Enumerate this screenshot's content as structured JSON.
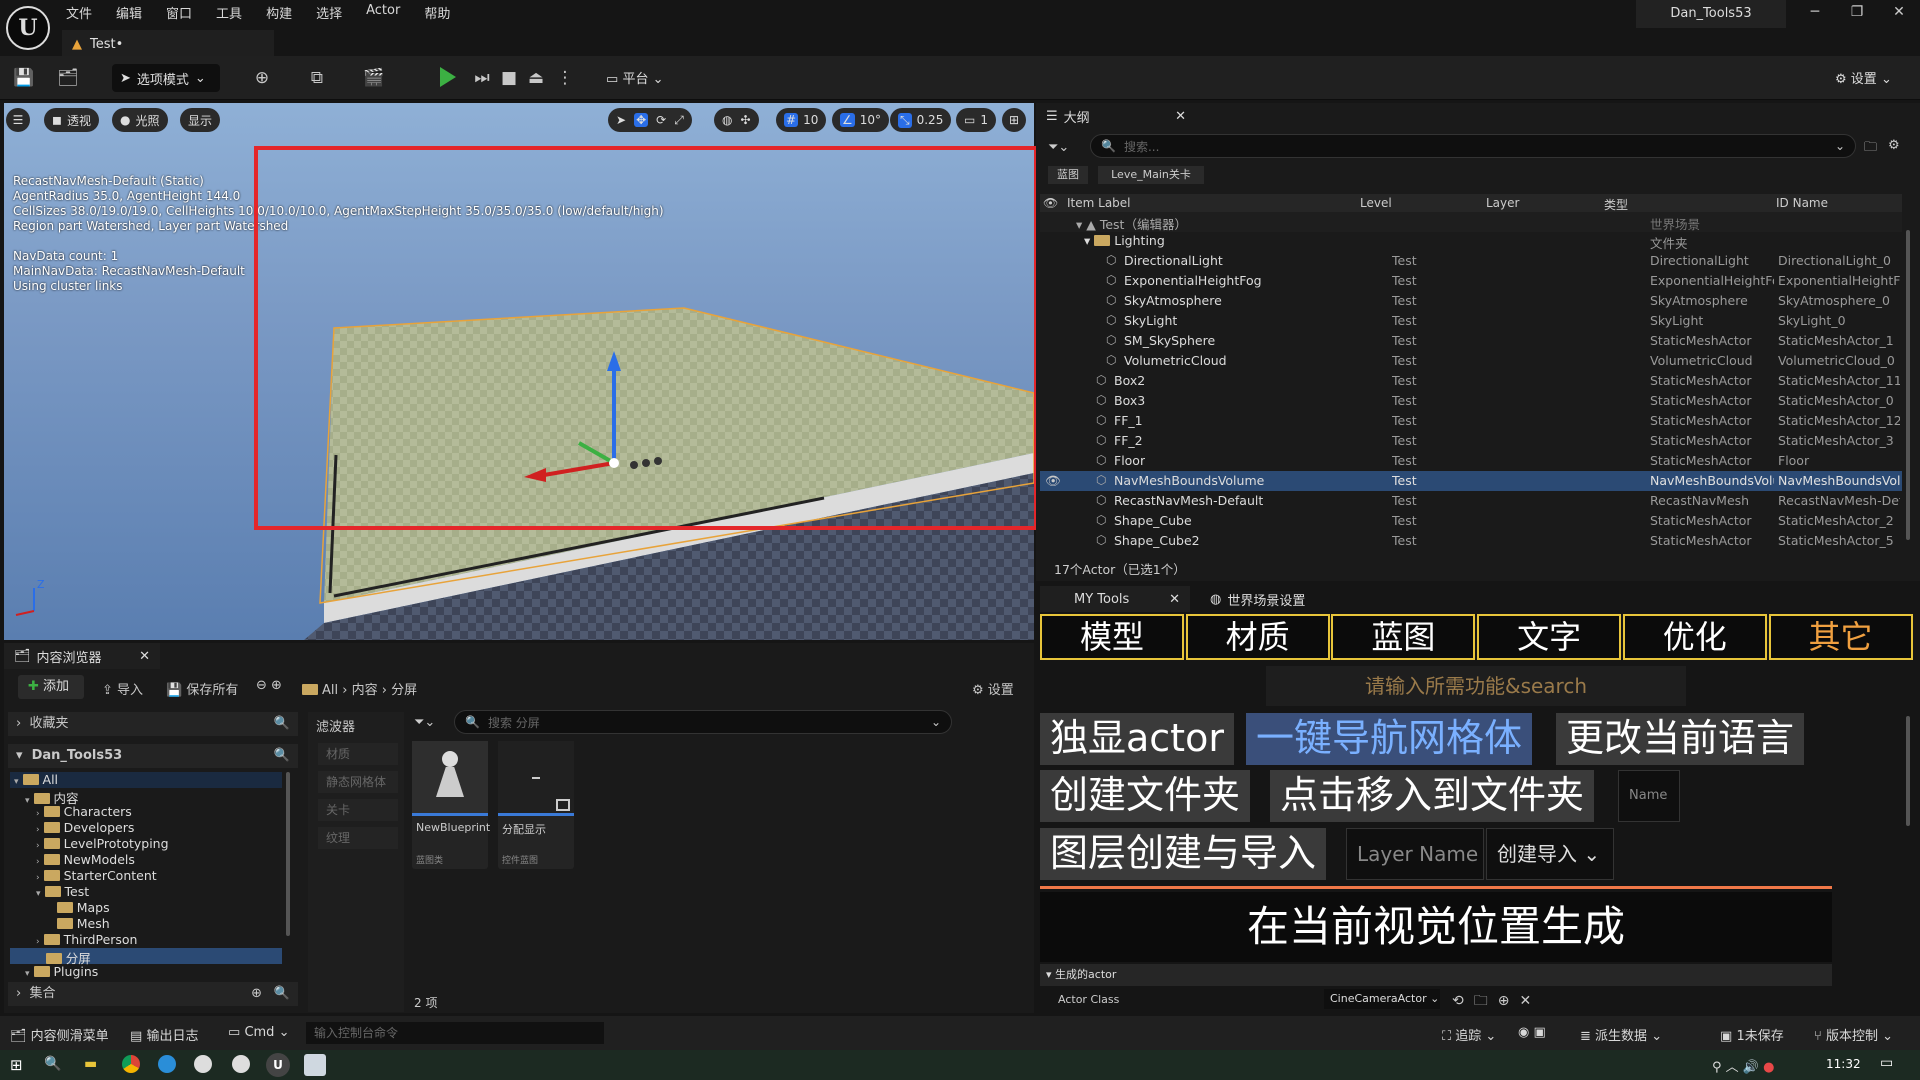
{
  "menu": [
    "文件",
    "编辑",
    "窗口",
    "工具",
    "构建",
    "选择",
    "Actor",
    "帮助"
  ],
  "doc_tab": "Test•",
  "project": "Dan_Tools53",
  "toolbar": {
    "mode": "选项模式",
    "platform": "平台",
    "settings": "设置"
  },
  "viewport": {
    "buttons": [
      "透视",
      "光照",
      "显示"
    ],
    "grid": "10",
    "angle": "10°",
    "scale": "0.25",
    "camera": "1",
    "info": [
      "RecastNavMesh-Default (Static)",
      "AgentRadius 35.0, AgentHeight 144.0",
      "CellSizes 38.0/19.0/19.0, CellHeights 10.0/10.0/10.0, AgentMaxStepHeight 35.0/35.0/35.0 (low/default/high)",
      "Region part Watershed, Layer part Watershed"
    ],
    "info2": [
      "NavData count: 1",
      "MainNavData: RecastNavMesh-Default",
      "Using cluster links"
    ]
  },
  "outliner": {
    "tab": "大纲",
    "search": "搜索...",
    "chips": [
      "蓝图",
      "Leve_Main关卡"
    ],
    "columns": [
      "Item Label",
      "Level",
      "Layer",
      "类型",
      "ID Name"
    ],
    "world": "Test（编辑器）",
    "world_type": "世界场景",
    "folder": "Lighting",
    "folder_type": "文件夹",
    "rows": [
      {
        "name": "DirectionalLight",
        "level": "Test",
        "type": "DirectionalLight",
        "id": "DirectionalLight_0",
        "indent": 2
      },
      {
        "name": "ExponentialHeightFog",
        "level": "Test",
        "type": "ExponentialHeightFog",
        "id": "ExponentialHeightFog",
        "indent": 2
      },
      {
        "name": "SkyAtmosphere",
        "level": "Test",
        "type": "SkyAtmosphere",
        "id": "SkyAtmosphere_0",
        "indent": 2
      },
      {
        "name": "SkyLight",
        "level": "Test",
        "type": "SkyLight",
        "id": "SkyLight_0",
        "indent": 2
      },
      {
        "name": "SM_SkySphere",
        "level": "Test",
        "type": "StaticMeshActor",
        "id": "StaticMeshActor_1",
        "indent": 2
      },
      {
        "name": "VolumetricCloud",
        "level": "Test",
        "type": "VolumetricCloud",
        "id": "VolumetricCloud_0",
        "indent": 2
      },
      {
        "name": "Box2",
        "level": "Test",
        "type": "StaticMeshActor",
        "id": "StaticMeshActor_11",
        "indent": 1
      },
      {
        "name": "Box3",
        "level": "Test",
        "type": "StaticMeshActor",
        "id": "StaticMeshActor_0",
        "indent": 1
      },
      {
        "name": "FF_1",
        "level": "Test",
        "type": "StaticMeshActor",
        "id": "StaticMeshActor_12",
        "indent": 1
      },
      {
        "name": "FF_2",
        "level": "Test",
        "type": "StaticMeshActor",
        "id": "StaticMeshActor_3",
        "indent": 1
      },
      {
        "name": "Floor",
        "level": "Test",
        "type": "StaticMeshActor",
        "id": "Floor",
        "indent": 1
      },
      {
        "name": "NavMeshBoundsVolume",
        "level": "Test",
        "type": "NavMeshBoundsVolume",
        "id": "NavMeshBoundsVolume",
        "indent": 1,
        "selected": true
      },
      {
        "name": "RecastNavMesh-Default",
        "level": "Test",
        "type": "RecastNavMesh",
        "id": "RecastNavMesh-Default",
        "indent": 1
      },
      {
        "name": "Shape_Cube",
        "level": "Test",
        "type": "StaticMeshActor",
        "id": "StaticMeshActor_2",
        "indent": 1
      },
      {
        "name": "Shape_Cube2",
        "level": "Test",
        "type": "StaticMeshActor",
        "id": "StaticMeshActor_5",
        "indent": 1
      }
    ],
    "count": "17个Actor（已选1个）"
  },
  "mytools": {
    "tab": "MY Tools",
    "tab2": "世界场景设置",
    "categories": [
      "模型",
      "材质",
      "蓝图",
      "文字",
      "优化",
      "其它"
    ],
    "search": "请输入所需功能&search",
    "b1": "独显actor",
    "b2": "一键导航网格体",
    "b3": "更改当前语言",
    "b4": "创建文件夹",
    "b5": "点击移入到文件夹",
    "name_ph": "Name",
    "b6": "图层创建与导入",
    "layer_ph": "Layer Name",
    "b7": "创建导入",
    "b8": "在当前视觉位置生成",
    "spawn_section": "生成的actor",
    "actor_class": "Actor Class",
    "actor_class_value": "CineCameraActor"
  },
  "content": {
    "tab": "内容浏览器",
    "add": "添加",
    "import": "导入",
    "save_all": "保存所有",
    "path": [
      "All",
      "内容",
      "分屏"
    ],
    "settings": "设置",
    "favorites": "收藏夹",
    "project": "Dan_Tools53",
    "collections": "集合",
    "tree": [
      {
        "label": "All",
        "depth": 0
      },
      {
        "label": "内容",
        "depth": 1
      },
      {
        "label": "Characters",
        "depth": 2
      },
      {
        "label": "Developers",
        "depth": 2
      },
      {
        "label": "LevelPrototyping",
        "depth": 2
      },
      {
        "label": "NewModels",
        "depth": 2
      },
      {
        "label": "StarterContent",
        "depth": 2
      },
      {
        "label": "Test",
        "depth": 2
      },
      {
        "label": "Maps",
        "depth": 3
      },
      {
        "label": "Mesh",
        "depth": 3
      },
      {
        "label": "ThirdPerson",
        "depth": 2
      },
      {
        "label": "分屏",
        "depth": 2,
        "selected": true
      },
      {
        "label": "Plugins",
        "depth": 1
      }
    ],
    "filters_title": "滤波器",
    "filters": [
      "材质",
      "静态网格体",
      "关卡",
      "纹理"
    ],
    "search": "搜索 分屏",
    "assets": [
      {
        "name": "NewBlueprint",
        "type": "蓝图类"
      },
      {
        "name": "分配显示",
        "type": "控件蓝图"
      }
    ],
    "items": "2 项"
  },
  "status": {
    "drawer": "内容侧滑菜单",
    "log": "输出日志",
    "cmd": "Cmd",
    "console_ph": "输入控制台命令",
    "trace": "追踪",
    "derived": "派生数据",
    "unsaved": "1未保存",
    "vcs": "版本控制"
  },
  "taskbar": {
    "time": "11:32"
  }
}
